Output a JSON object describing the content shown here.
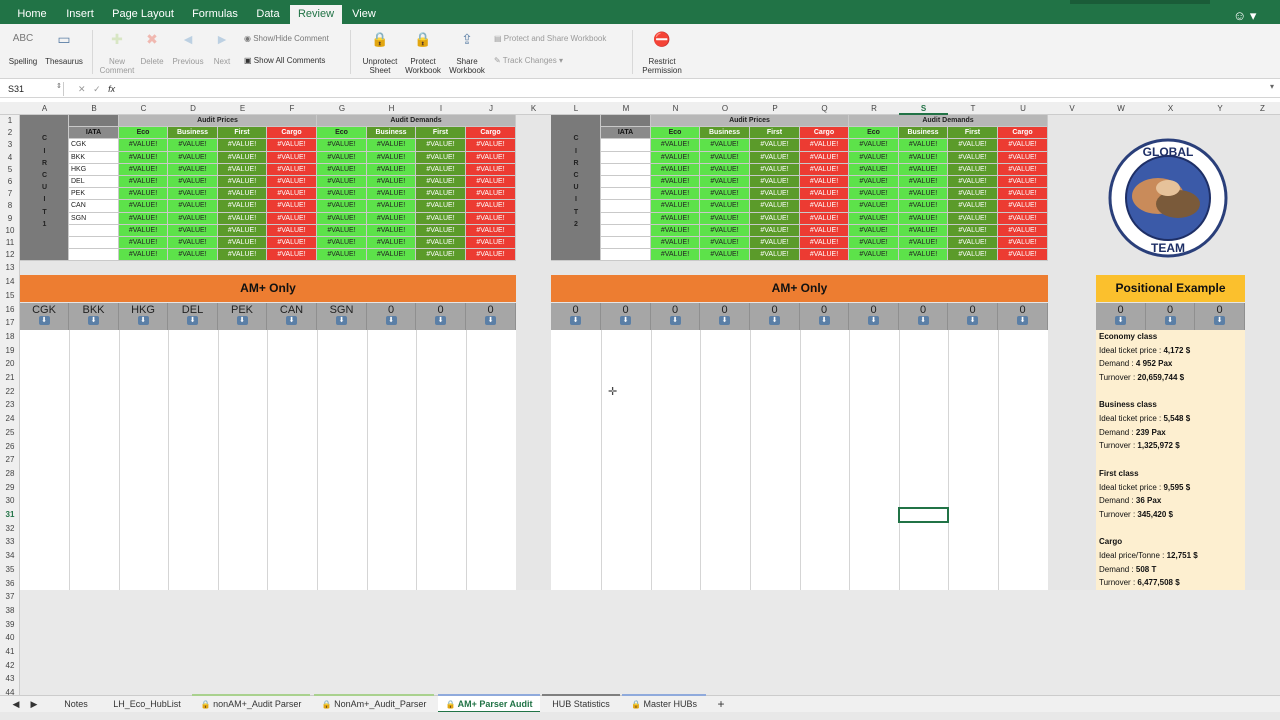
{
  "ribbon": {
    "tabs": [
      "Home",
      "Insert",
      "Page Layout",
      "Formulas",
      "Data",
      "Review",
      "View"
    ],
    "active_tab": "Review",
    "title": "",
    "buttons": {
      "spelling": "Spelling",
      "thesaurus": "Thesaurus",
      "new_comment": "New Comment",
      "delete": "Delete",
      "previous": "Previous",
      "next": "Next",
      "show_hide_comment": "Show/Hide Comment",
      "show_all_comments": "Show All Comments",
      "unprotect_sheet": "Unprotect Sheet",
      "protect_workbook": "Protect Workbook",
      "share_workbook": "Share Workbook",
      "protect_and_share": "Protect and Share Workbook",
      "track_changes": "Track Changes",
      "restrict_permission": "Restrict Permission"
    },
    "spelling_icon_text": "ABC"
  },
  "formula_bar": {
    "name_box": "S31",
    "fx": "fx",
    "formula": ""
  },
  "columns": [
    "A",
    "B",
    "C",
    "D",
    "E",
    "F",
    "G",
    "H",
    "I",
    "J",
    "K",
    "L",
    "M",
    "N",
    "O",
    "P",
    "Q",
    "R",
    "S",
    "T",
    "U",
    "V",
    "W",
    "X",
    "Y",
    "Z"
  ],
  "selected_column": "S",
  "rows": [
    "1",
    "2",
    "3",
    "4",
    "5",
    "6",
    "7",
    "8",
    "9",
    "10",
    "11",
    "12",
    "13",
    "14",
    "15",
    "16",
    "17",
    "18",
    "19",
    "20",
    "21",
    "22",
    "23",
    "24",
    "25",
    "26",
    "27",
    "28",
    "29",
    "30",
    "31",
    "32",
    "33",
    "34",
    "35",
    "36",
    "37",
    "38",
    "39",
    "40",
    "41",
    "42",
    "43",
    "44"
  ],
  "selected_row": "31",
  "circuit1": {
    "label_letters": [
      "C",
      "I",
      "R",
      "C",
      "U",
      "I",
      "T",
      "",
      "1"
    ],
    "iata_header": "IATA",
    "iata": [
      "CGK",
      "BKK",
      "HKG",
      "DEL",
      "PEK",
      "CAN",
      "SGN",
      "",
      "",
      ""
    ],
    "audit_prices_label": "Audit Prices",
    "audit_demands_label": "Audit Demands",
    "class_headers": [
      "Eco",
      "Business",
      "First",
      "Cargo"
    ],
    "error_value": "#VALUE!",
    "am_only_label": "AM+ Only",
    "hub_cells": [
      "CGK",
      "BKK",
      "HKG",
      "DEL",
      "PEK",
      "CAN",
      "SGN",
      "0",
      "0",
      "0"
    ]
  },
  "circuit2": {
    "label_letters": [
      "C",
      "I",
      "R",
      "C",
      "U",
      "I",
      "T",
      "",
      "2"
    ],
    "iata_header": "IATA",
    "audit_prices_label": "Audit Prices",
    "audit_demands_label": "Audit Demands",
    "class_headers": [
      "Eco",
      "Business",
      "First",
      "Cargo"
    ],
    "error_value": "#VALUE!",
    "am_only_label": "AM+ Only",
    "hub_cells": [
      "0",
      "0",
      "0",
      "0",
      "0",
      "0",
      "0",
      "0",
      "0",
      "0"
    ]
  },
  "positional": {
    "title": "Positional Example",
    "hub_cells": [
      "0",
      "0",
      "0"
    ],
    "lines": [
      {
        "label": "Economy class",
        "value": "",
        "bold_label": true
      },
      {
        "label": "Ideal ticket price : ",
        "value": "4,172 $"
      },
      {
        "label": "Demand : ",
        "value": "4 952 Pax"
      },
      {
        "label": "Turnover : ",
        "value": "20,659,744 $"
      },
      {
        "label": "",
        "value": ""
      },
      {
        "label": "Business class",
        "value": "",
        "bold_label": true
      },
      {
        "label": "Ideal ticket price : ",
        "value": "5,548 $"
      },
      {
        "label": "Demand : ",
        "value": "239 Pax"
      },
      {
        "label": "Turnover : ",
        "value": "1,325,972 $"
      },
      {
        "label": "",
        "value": ""
      },
      {
        "label": "First class",
        "value": "",
        "bold_label": true
      },
      {
        "label": "Ideal ticket price : ",
        "value": "9,595 $"
      },
      {
        "label": "Demand : ",
        "value": "36 Pax"
      },
      {
        "label": "Turnover : ",
        "value": "345,420 $"
      },
      {
        "label": "",
        "value": ""
      },
      {
        "label": "Cargo",
        "value": "",
        "bold_label": true
      },
      {
        "label": "Ideal price/Tonne : ",
        "value": "12,751 $"
      },
      {
        "label": "Demand : ",
        "value": "508 T"
      },
      {
        "label": "Turnover : ",
        "value": "6,477,508 $"
      }
    ]
  },
  "logo": {
    "text_top": "GLOBAL",
    "text_bottom": "TEAM"
  },
  "sheet_tabs": [
    {
      "label": "Notes",
      "locked": false,
      "color": ""
    },
    {
      "label": "LH_Eco_HubList",
      "locked": false,
      "color": ""
    },
    {
      "label": "nonAM+_Audit Parser",
      "locked": true,
      "color": "#a9d18e"
    },
    {
      "label": "NonAm+_Audit_Parser",
      "locked": true,
      "color": "#a9d18e"
    },
    {
      "label": "AM+ Parser Audit",
      "locked": true,
      "color": "#8faadc",
      "active": true
    },
    {
      "label": "HUB Statistics",
      "locked": false,
      "color": "#7f7f7f"
    },
    {
      "label": "Master HUBs",
      "locked": true,
      "color": "#8faadc"
    }
  ],
  "add_sheet": "+",
  "lock_icon": "🔒",
  "colors": {
    "ribbon_green": "#217346",
    "cell_green": "#5de24a",
    "cell_red": "#ec3b32",
    "cell_dark_green": "#5b9b2a",
    "orange": "#ed7d31",
    "yellow": "#fbc02d",
    "circuit_grey": "#7a7a7a"
  }
}
